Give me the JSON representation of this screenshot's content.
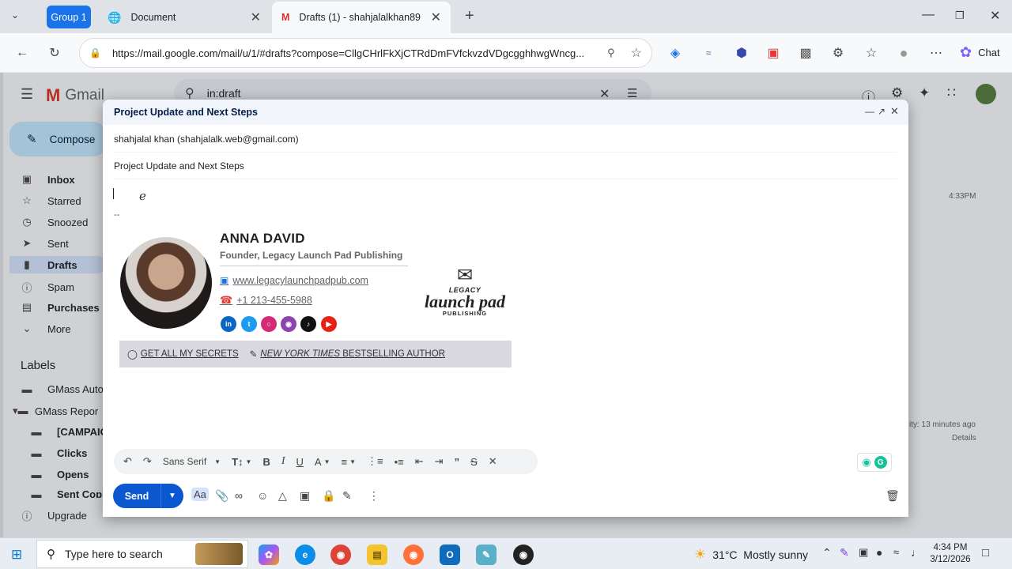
{
  "browser": {
    "tab_group": "Group 1",
    "tabs": [
      {
        "title": "Document"
      },
      {
        "title": "Drafts (1) - shahjalalkhan89"
      }
    ],
    "url": "https://mail.google.com/mail/u/1/#drafts?compose=CllgCHrlFkXjCTRdDmFVfckvzdVDgcgghhwgWncg...",
    "chat_label": "Chat"
  },
  "gmail": {
    "logo_text": "Gmail",
    "search_value": "in:draft",
    "compose_label": "Compose",
    "nav": [
      "Inbox",
      "Starred",
      "Snoozed",
      "Sent",
      "Drafts",
      "Spam",
      "Purchases",
      "More"
    ],
    "labels_heading": "Labels",
    "labels": [
      "GMass Auto",
      "GMass Repor",
      "[CAMPAIG",
      "Clicks",
      "Opens",
      "Sent Copie"
    ],
    "upgrade": "Upgrade",
    "row_time": "4:33PM",
    "activity": "ity: 13 minutes ago",
    "details": "Details"
  },
  "compose": {
    "header_title": "Project Update and Next Steps",
    "recipient": "shahjalal khan (shahjalalk.web@gmail.com)",
    "subject": "Project Update and Next Steps",
    "sig_separator": "--",
    "signature": {
      "name": "ANNA DAVID",
      "title": "Founder, Legacy Launch Pad Publishing",
      "website": "www.legacylaunchpadpub.com",
      "phone": "+1 213-455-5988",
      "logo_top": "LEGACY",
      "logo_main": "launch pad",
      "logo_bottom": "PUBLISHING",
      "banner_left": "GET ALL MY SECRETS",
      "banner_right_italic": "NEW YORK TIMES",
      "banner_right": " BESTSELLING AUTHOR"
    },
    "font_name": "Sans Serif",
    "send_label": "Send"
  },
  "taskbar": {
    "search_placeholder": "Type here to search",
    "weather": "31°C  Mostly sunny",
    "time": "4:34 PM",
    "date": "3/12/2026"
  }
}
